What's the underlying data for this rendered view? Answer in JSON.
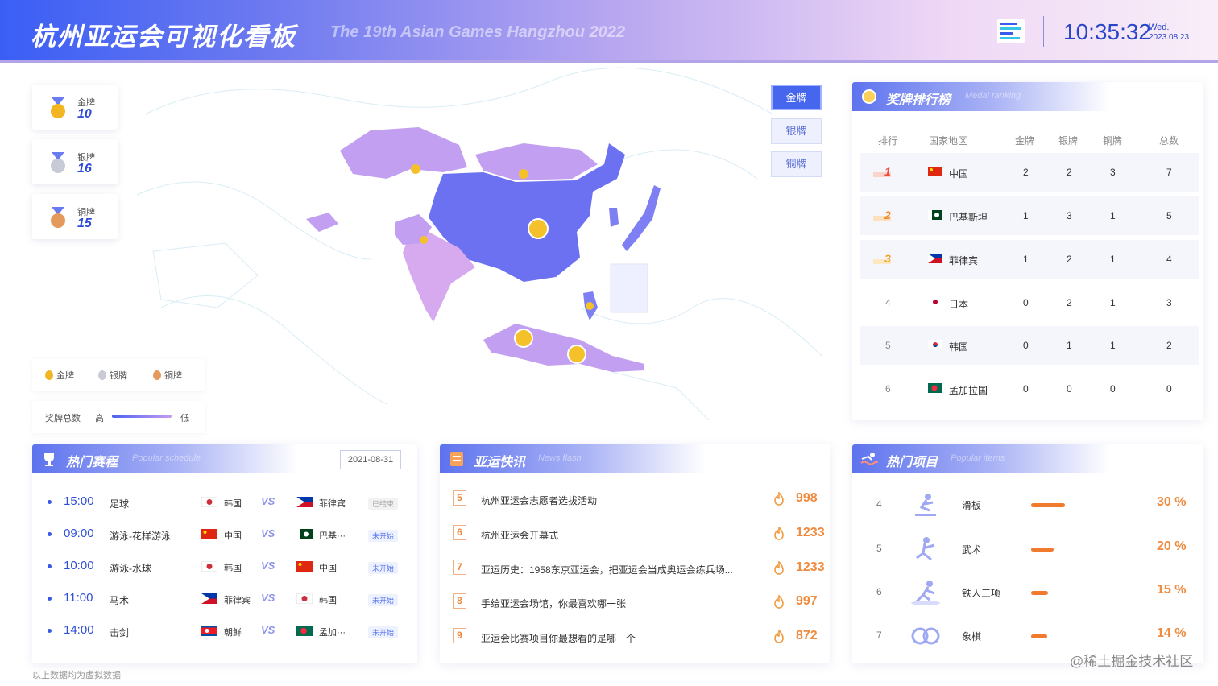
{
  "header": {
    "title": "杭州亚运会可视化看板",
    "subtitle": "The 19th Asian Games Hangzhou 2022",
    "time": "10:35:32",
    "weekday": "Wed.",
    "date": "2023.08.23",
    "logo_icon": "hangzhou-logo-icon"
  },
  "medal_totals": [
    {
      "label": "金牌",
      "value": "10",
      "icon": "gold-medal-icon",
      "color": "#f3b522"
    },
    {
      "label": "银牌",
      "value": "16",
      "icon": "silver-medal-icon",
      "color": "#c8cbd6"
    },
    {
      "label": "铜牌",
      "value": "15",
      "icon": "bronze-medal-icon",
      "color": "#e39a5c"
    }
  ],
  "map": {
    "buttons": [
      {
        "label": "金牌",
        "active": true
      },
      {
        "label": "银牌",
        "active": false
      },
      {
        "label": "铜牌",
        "active": false
      }
    ],
    "legend": [
      "金牌",
      "银牌",
      "铜牌"
    ],
    "scale_label": "奖牌总数",
    "scale_high": "高",
    "scale_low": "低",
    "highlight_color": "#6b71f0",
    "secondary_color": "#c5a2ef"
  },
  "ranking": {
    "title": "奖牌排行榜",
    "subtitle": "Medal ranking",
    "columns": [
      "排行",
      "国家地区",
      "金牌",
      "银牌",
      "铜牌",
      "总数"
    ],
    "rows": [
      {
        "rank": "1",
        "country": "中国",
        "gold": "2",
        "silver": "2",
        "bronze": "3",
        "total": "7"
      },
      {
        "rank": "2",
        "country": "巴基斯坦",
        "gold": "1",
        "silver": "3",
        "bronze": "1",
        "total": "5"
      },
      {
        "rank": "3",
        "country": "菲律宾",
        "gold": "1",
        "silver": "2",
        "bronze": "1",
        "total": "4"
      },
      {
        "rank": "4",
        "country": "日本",
        "gold": "0",
        "silver": "2",
        "bronze": "1",
        "total": "3"
      },
      {
        "rank": "5",
        "country": "韩国",
        "gold": "0",
        "silver": "1",
        "bronze": "1",
        "total": "2"
      },
      {
        "rank": "6",
        "country": "孟加拉国",
        "gold": "0",
        "silver": "0",
        "bronze": "0",
        "total": "0"
      }
    ]
  },
  "schedule": {
    "title": "热门赛程",
    "subtitle": "Popular schedule",
    "date": "2021-08-31",
    "vs": "VS",
    "rows": [
      {
        "time": "15:00",
        "sport": "足球",
        "team1": "韩国",
        "team2": "菲律宾",
        "status": "已结束",
        "done": true
      },
      {
        "time": "09:00",
        "sport": "游泳-花样游泳",
        "team1": "中国",
        "team2": "巴基···",
        "status": "未开始",
        "done": false
      },
      {
        "time": "10:00",
        "sport": "游泳-水球",
        "team1": "韩国",
        "team2": "中国",
        "status": "未开始",
        "done": false
      },
      {
        "time": "11:00",
        "sport": "马术",
        "team1": "菲律宾",
        "team2": "韩国",
        "status": "未开始",
        "done": false
      },
      {
        "time": "14:00",
        "sport": "击剑",
        "team1": "朝鲜",
        "team2": "孟加···",
        "status": "未开始",
        "done": false
      }
    ]
  },
  "news": {
    "title": "亚运快讯",
    "subtitle": "News flash",
    "rows": [
      {
        "no": "5",
        "text": "杭州亚运会志愿者选拔活动",
        "count": "998"
      },
      {
        "no": "6",
        "text": "杭州亚运会开幕式",
        "count": "1233"
      },
      {
        "no": "7",
        "text": "亚运历史：1958东京亚运会，把亚运会当成奥运会练兵场...",
        "count": "1233"
      },
      {
        "no": "8",
        "text": "手绘亚运会场馆，你最喜欢哪一张",
        "count": "997"
      },
      {
        "no": "9",
        "text": "亚运会比赛项目你最想看的是哪一个",
        "count": "872"
      }
    ]
  },
  "items": {
    "title": "热门项目",
    "subtitle": "Popular items",
    "rows": [
      {
        "idx": "4",
        "name": "滑板",
        "pct": "30 %",
        "value": 30
      },
      {
        "idx": "5",
        "name": "武术",
        "pct": "20 %",
        "value": 20
      },
      {
        "idx": "6",
        "name": "铁人三项",
        "pct": "15 %",
        "value": 15
      },
      {
        "idx": "7",
        "name": "象棋",
        "pct": "14 %",
        "value": 14
      }
    ]
  },
  "footer": "以上数据均为虚拟数据",
  "watermark": "@稀土掘金技术社区"
}
